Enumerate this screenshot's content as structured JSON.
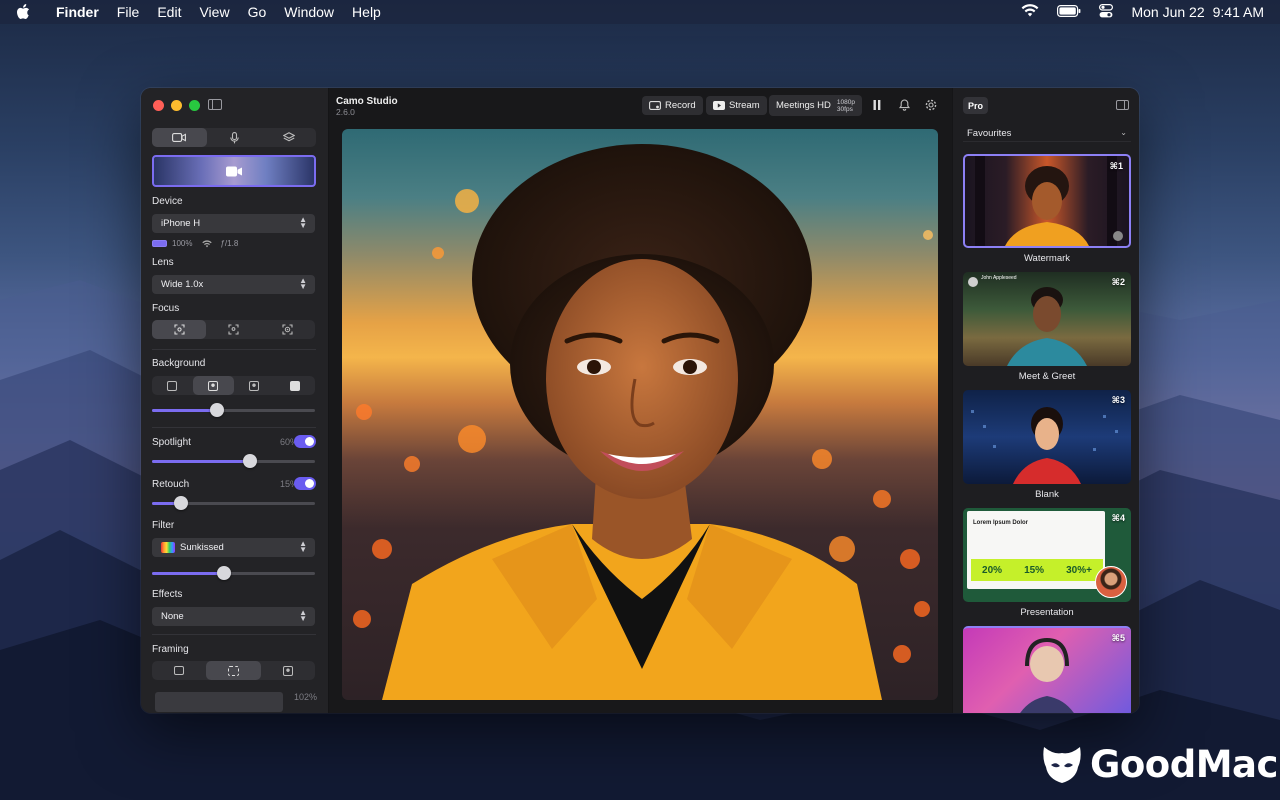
{
  "menubar": {
    "apple_icon": "apple-icon",
    "items": [
      "Finder",
      "File",
      "Edit",
      "View",
      "Go",
      "Window",
      "Help"
    ],
    "date": "Mon Jun 22",
    "time": "9:41 AM"
  },
  "app": {
    "title": "Camo Studio",
    "version": "2.6.0"
  },
  "toolbar": {
    "record_label": "Record",
    "stream_label": "Stream",
    "meetings_label": "Meetings HD",
    "resolution": "1080p",
    "fps": "30fps"
  },
  "left_panel": {
    "source_tabs": [
      "video-icon",
      "microphone-icon",
      "layers-icon"
    ],
    "device_label": "Device",
    "device_value": "iPhone H",
    "battery": "100%",
    "aperture": "ƒ/1.8",
    "lens_label": "Lens",
    "lens_value": "Wide 1.0x",
    "focus_label": "Focus",
    "background_label": "Background",
    "background_blur_level": 0.4,
    "spotlight_label": "Spotlight",
    "spotlight_pct": "60%",
    "spotlight_level": 0.6,
    "retouch_label": "Retouch",
    "retouch_pct": "15%",
    "retouch_level": 0.18,
    "filter_label": "Filter",
    "filter_value": "Sunkissed",
    "filter_level": 0.44,
    "effects_label": "Effects",
    "effects_value": "None",
    "framing_label": "Framing",
    "zoom_pct": "102%"
  },
  "right_panel": {
    "pro_badge": "Pro",
    "favourites_label": "Favourites",
    "scenes": [
      {
        "name": "Watermark",
        "shortcut": "⌘1"
      },
      {
        "name": "Meet & Greet",
        "shortcut": "⌘2"
      },
      {
        "name": "Blank",
        "shortcut": "⌘3"
      },
      {
        "name": "Presentation",
        "shortcut": "⌘4"
      },
      {
        "name": "",
        "shortcut": "⌘5"
      }
    ],
    "meet_user": "John Appleseed",
    "presentation": {
      "title": "Lorem Ipsum Dolor",
      "stats": [
        "20%",
        "15%",
        "30%+"
      ]
    }
  },
  "watermark": {
    "brand": "GoodMac"
  }
}
